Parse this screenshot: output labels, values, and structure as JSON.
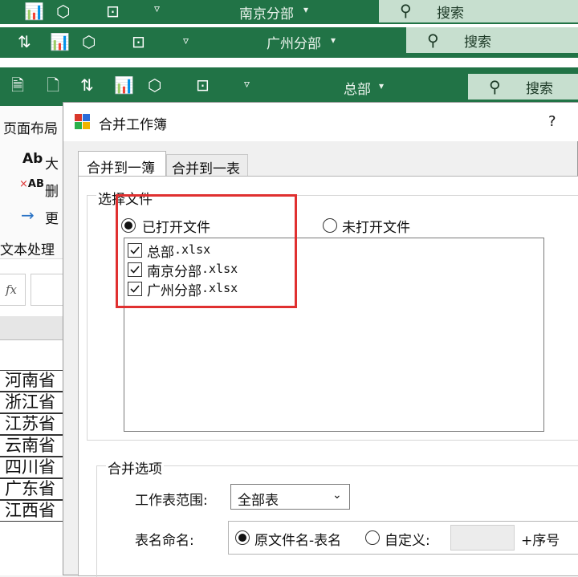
{
  "windows": {
    "back2": {
      "title": "南京分部",
      "search": "搜索"
    },
    "back1": {
      "title": "广州分部",
      "search": "搜索"
    },
    "front": {
      "title": "总部",
      "search": "搜索"
    }
  },
  "excel": {
    "ribbon_tab": "页面布局",
    "ribbon_items": [
      "大",
      "删",
      "更"
    ],
    "group_label": "文本处理",
    "fx": "fx",
    "rows": [
      "河南省",
      "浙江省",
      "江苏省",
      "云南省",
      "四川省",
      "广东省",
      "江西省"
    ]
  },
  "dialog": {
    "title": "合并工作簿",
    "help": "?",
    "tabs": [
      "合并到一簿",
      "合并到一表"
    ],
    "file_group": "选择文件",
    "radio_open": "已打开文件",
    "radio_closed": "未打开文件",
    "files": [
      {
        "name_cn": "总部",
        "ext": ".xlsx",
        "checked": true
      },
      {
        "name_cn": "南京分部",
        "ext": ".xlsx",
        "checked": true
      },
      {
        "name_cn": "广州分部",
        "ext": ".xlsx",
        "checked": true
      }
    ],
    "options_group": "合并选项",
    "sheet_range_label": "工作表范围:",
    "sheet_range_value": "全部表",
    "naming_label": "表名命名:",
    "naming_opt1": "原文件名-表名",
    "naming_opt2": "自定义:",
    "naming_suffix": "+序号",
    "custom_value": ""
  },
  "colors": {
    "excel_green": "#217346",
    "highlight_red": "#e03030"
  }
}
